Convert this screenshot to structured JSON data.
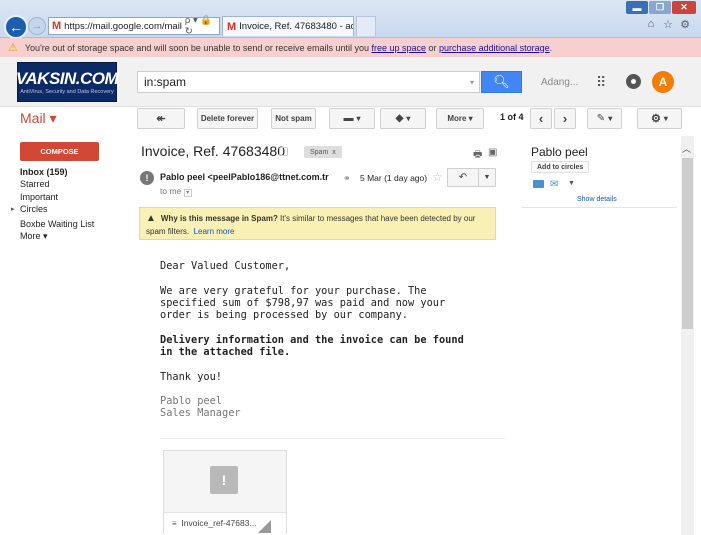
{
  "browser": {
    "url": "https://mail.google.com/mail",
    "address_icons": "ρ ▾ 🔒 ↻",
    "tab_title": "Invoice, Ref. 47683480 - ad...",
    "tab_close": "×"
  },
  "warning_bar": {
    "text_before": "You're out of storage space and will soon be unable to send or receive emails until you ",
    "link1": "free up space",
    "text_middle": " or ",
    "link2": "purchase additional storage",
    "text_after": "."
  },
  "header": {
    "logo_text": "VAKSIN.COM",
    "logo_sub": "AntiVirus, Security and Data Recovery",
    "search_value": "in:spam",
    "user_name": "Adang...",
    "avatar_letter": "A"
  },
  "toolbar": {
    "mail_label": "Mail ▾",
    "back_icon": "↞",
    "delete_forever": "Delete forever",
    "not_spam": "Not spam",
    "folder_label": "▾",
    "tag_label": "▾",
    "more": "More ▾",
    "page_count": "1 of 4",
    "prev": "‹",
    "next": "›",
    "edit_label": "▾",
    "settings_label": "▾"
  },
  "sidebar": {
    "compose": "COMPOSE",
    "items": [
      {
        "label": "Inbox (159)"
      },
      {
        "label": "Starred"
      },
      {
        "label": "Important"
      },
      {
        "label": "Circles"
      },
      {
        "label": "Boxbe Waiting List"
      },
      {
        "label": "More ▾"
      }
    ]
  },
  "message": {
    "subject": "Invoice, Ref. 47683480",
    "label": "Spam",
    "label_close": "x",
    "sender_initial": "!",
    "sender": "Pablo peel <peelPablo186@ttnet.com.tr",
    "to": "to me",
    "date": "5 Mar (1 day ago)",
    "spam_warning_bold": "Why is this message in Spam?",
    "spam_warning_text": " It's similar to messages that have been detected by our spam filters.",
    "spam_warning_link": "Learn more",
    "body": {
      "greeting": "Dear Valued Customer,",
      "p1": "We are very grateful for your purchase. The\nspecified sum of $798,97 was paid and now your\norder is being processed by our company.",
      "p2": "Delivery information and the invoice can be found\nin the attached file.",
      "thanks": "Thank you!",
      "sig": "Pablo peel\nSales Manager"
    },
    "attachment_name": "Invoice_ref-47683...",
    "attachment_thumb": "!"
  },
  "contact": {
    "name": "Pablo peel",
    "add_circles": "Add to circles",
    "show_details": "Show details"
  },
  "colors": {
    "accent_red": "#d14836",
    "search_blue": "#4285f4",
    "warning_pink": "#f8cfcf",
    "spam_yellow": "#f9f0b5"
  }
}
